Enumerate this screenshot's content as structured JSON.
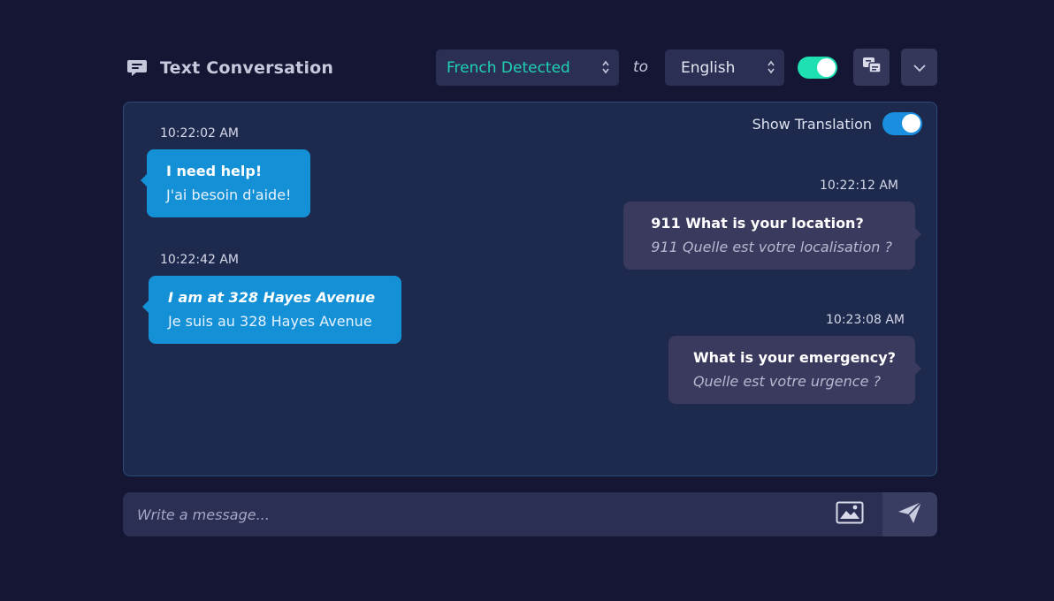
{
  "header": {
    "title": "Text Conversation",
    "source_language": "French Detected",
    "to_word": "to",
    "target_language": "English",
    "translation_toggle_on": true
  },
  "panel": {
    "show_translation_label": "Show Translation",
    "show_translation_on": true,
    "messages": [
      {
        "time": "10:22:02 AM",
        "direction": "in",
        "original": "I need help!",
        "translation": "J'ai besoin d'aide!"
      },
      {
        "time": "10:22:12 AM",
        "direction": "out",
        "original": "911 What is your location?",
        "translation": "911 Quelle est votre localisation ?"
      },
      {
        "time": "10:22:42 AM",
        "direction": "in",
        "original": "I am at 328 Hayes Avenue",
        "translation": "Je suis au 328 Hayes Avenue"
      },
      {
        "time": "10:23:08 AM",
        "direction": "out",
        "original": "What is your emergency?",
        "translation": "Quelle est votre urgence ?"
      }
    ]
  },
  "composer": {
    "placeholder": "Write a message..."
  },
  "colors": {
    "background": "#141634",
    "panel": "#1d2a4d",
    "incoming_bubble": "#1490d6",
    "outgoing_bubble": "#3a3a5e",
    "detected_accent": "#1fd2b4",
    "toggle_green": "#1ee0b0",
    "toggle_blue": "#1a8fe0"
  },
  "icons": {
    "title": "chat-bubble-icon",
    "translate": "translate-icon",
    "collapse": "chevron-down-icon",
    "image": "image-icon",
    "send": "send-icon"
  }
}
